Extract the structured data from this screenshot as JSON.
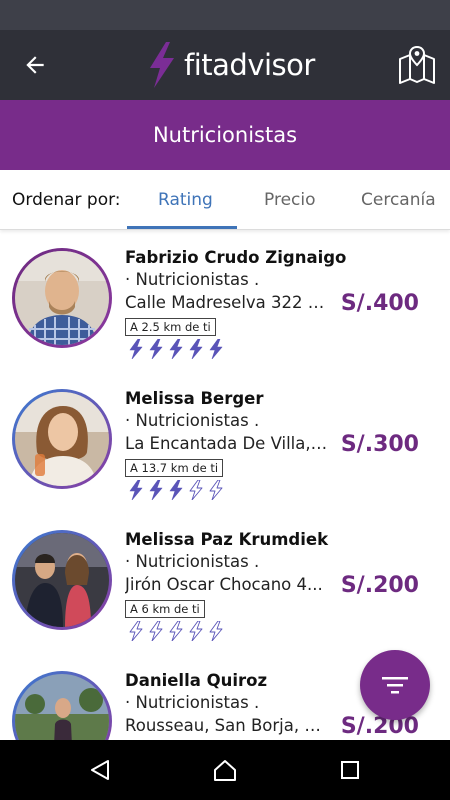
{
  "app_bar": {
    "back_icon": "arrow-left-icon",
    "logo_text": "fitadvisor",
    "map_icon": "map-pin-icon"
  },
  "title": "Nutricionistas",
  "sort": {
    "label": "Ordenar por:",
    "tabs": [
      {
        "label": "Rating",
        "active": true
      },
      {
        "label": "Precio",
        "active": false
      },
      {
        "label": "Cercanía",
        "active": false
      }
    ]
  },
  "colors": {
    "accent": "#782c8a",
    "price": "#6d2a80",
    "tab_active": "#3f74b8",
    "bolt": "#5a54b8",
    "app_bar": "#2f3038"
  },
  "items": [
    {
      "name": "Fabrizio Crudo Zignaigo",
      "category": "· Nutricionistas .",
      "address": "Calle Madreselva 322 S...",
      "distance": "A 2.5 km de ti",
      "rating": 5,
      "price": "S/.400"
    },
    {
      "name": "Melissa Berger",
      "category": "· Nutricionistas .",
      "address": "La Encantada De Villa, ...",
      "distance": "A 13.7 km de ti",
      "rating": 3,
      "price": "S/.300"
    },
    {
      "name": "Melissa Paz Krumdiek",
      "category": "· Nutricionistas .",
      "address": "Jirón Oscar Chocano 4...",
      "distance": "A 6 km de ti",
      "rating": 0,
      "price": "S/.200"
    },
    {
      "name": "Daniella Quiroz",
      "category": "· Nutricionistas .",
      "address": "Rousseau, San Borja, D...",
      "distance": "",
      "rating": 0,
      "price": "S/.200"
    }
  ],
  "fab_icon": "filter-icon",
  "nav": {
    "back_icon": "nav-back-icon",
    "home_icon": "nav-home-icon",
    "recents_icon": "nav-recents-icon"
  }
}
